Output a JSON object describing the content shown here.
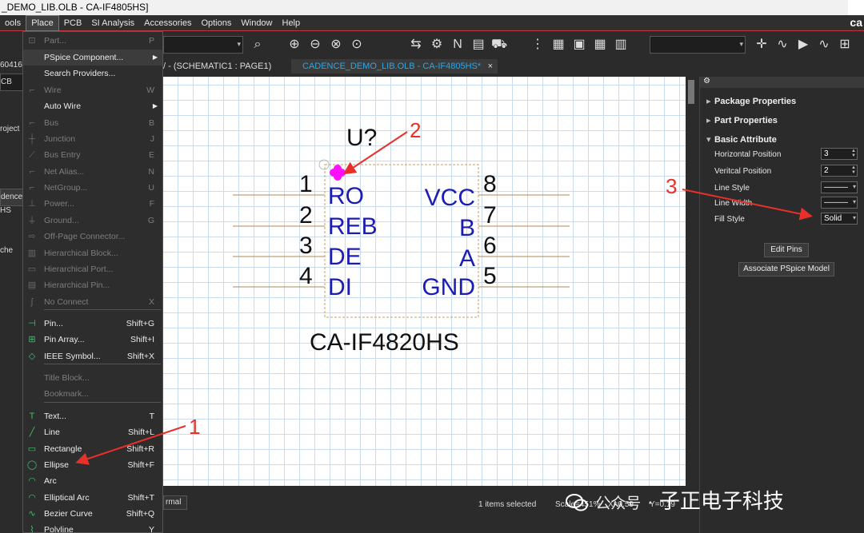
{
  "window": {
    "title": "_DEMO_LIB.OLB - CA-IF4805HS]"
  },
  "menu": {
    "items": [
      "ools",
      "Place",
      "PCB",
      "SI Analysis",
      "Accessories",
      "Options",
      "Window",
      "Help"
    ],
    "brand": "ca"
  },
  "left_panel": {
    "texts": [
      "60416",
      "CB",
      "roject",
      "dence",
      "HS",
      "che"
    ]
  },
  "tabs": {
    "inactive": "/ - (SCHEMATIC1 : PAGE1)",
    "active": "CADENCE_DEMO_LIB.OLB - CA-IF4805HS*",
    "close": "×"
  },
  "place_menu": {
    "items": [
      {
        "label": "Part...",
        "shortcut": "P",
        "enabled": false,
        "icon": "part-icon"
      },
      {
        "label": "PSpice Component...",
        "shortcut": "",
        "enabled": true,
        "submenu": true,
        "icon": ""
      },
      {
        "label": "Search Providers...",
        "shortcut": "",
        "enabled": true,
        "icon": ""
      },
      {
        "label": "Wire",
        "shortcut": "W",
        "enabled": false,
        "icon": "wire-icon"
      },
      {
        "label": "Auto Wire",
        "shortcut": "",
        "enabled": true,
        "submenu": true,
        "icon": ""
      },
      {
        "label": "Bus",
        "shortcut": "B",
        "enabled": false,
        "icon": "bus-icon"
      },
      {
        "label": "Junction",
        "shortcut": "J",
        "enabled": false,
        "icon": "junction-icon"
      },
      {
        "label": "Bus Entry",
        "shortcut": "E",
        "enabled": false,
        "icon": "bus-entry-icon"
      },
      {
        "label": "Net Alias...",
        "shortcut": "N",
        "enabled": false,
        "icon": "net-alias-icon"
      },
      {
        "label": "NetGroup...",
        "shortcut": "U",
        "enabled": false,
        "icon": "netgroup-icon"
      },
      {
        "label": "Power...",
        "shortcut": "F",
        "enabled": false,
        "icon": "power-icon"
      },
      {
        "label": "Ground...",
        "shortcut": "G",
        "enabled": false,
        "icon": "ground-icon"
      },
      {
        "label": "Off-Page Connector...",
        "shortcut": "",
        "enabled": false,
        "icon": "off-page-icon"
      },
      {
        "label": "Hierarchical Block...",
        "shortcut": "",
        "enabled": false,
        "icon": "hier-block-icon"
      },
      {
        "label": "Hierarchical Port...",
        "shortcut": "",
        "enabled": false,
        "icon": "hier-port-icon"
      },
      {
        "label": "Hierarchical Pin...",
        "shortcut": "",
        "enabled": false,
        "icon": "hier-pin-icon"
      },
      {
        "label": "No Connect",
        "shortcut": "X",
        "enabled": false,
        "icon": "no-connect-icon"
      },
      {
        "label": "Pin...",
        "shortcut": "Shift+G",
        "enabled": true,
        "icon": "pin-icon"
      },
      {
        "label": "Pin Array...",
        "shortcut": "Shift+I",
        "enabled": true,
        "icon": "pin-array-icon"
      },
      {
        "label": "IEEE Symbol...",
        "shortcut": "Shift+X",
        "enabled": true,
        "icon": "ieee-symbol-icon"
      },
      {
        "label": "Title Block...",
        "shortcut": "",
        "enabled": false,
        "icon": ""
      },
      {
        "label": "Bookmark...",
        "shortcut": "",
        "enabled": false,
        "icon": ""
      },
      {
        "label": "Text...",
        "shortcut": "T",
        "enabled": true,
        "icon": "text-icon"
      },
      {
        "label": "Line",
        "shortcut": "Shift+L",
        "enabled": true,
        "icon": "line-icon"
      },
      {
        "label": "Rectangle",
        "shortcut": "Shift+R",
        "enabled": true,
        "icon": "rectangle-icon"
      },
      {
        "label": "Ellipse",
        "shortcut": "Shift+F",
        "enabled": true,
        "icon": "ellipse-icon"
      },
      {
        "label": "Arc",
        "shortcut": "",
        "enabled": true,
        "icon": "arc-icon"
      },
      {
        "label": "Elliptical Arc",
        "shortcut": "Shift+T",
        "enabled": true,
        "icon": "elliptical-arc-icon"
      },
      {
        "label": "Bezier Curve",
        "shortcut": "Shift+Q",
        "enabled": true,
        "icon": "bezier-icon"
      },
      {
        "label": "Polyline",
        "shortcut": "Y",
        "enabled": true,
        "icon": "polyline-icon"
      }
    ]
  },
  "schematic": {
    "refdes": "U?",
    "part_name": "CA-IF4820HS",
    "left_pins": [
      {
        "num": "1",
        "name": "RO"
      },
      {
        "num": "2",
        "name": "REB"
      },
      {
        "num": "3",
        "name": "DE"
      },
      {
        "num": "4",
        "name": "DI"
      }
    ],
    "right_pins": [
      {
        "num": "8",
        "name": "VCC"
      },
      {
        "num": "7",
        "name": "B"
      },
      {
        "num": "6",
        "name": "A"
      },
      {
        "num": "5",
        "name": "GND"
      }
    ]
  },
  "properties": {
    "sections": [
      "Package Properties",
      "Part Properties",
      "Basic Attribute"
    ],
    "fields": [
      {
        "label": "Horizontal Position",
        "value": "3"
      },
      {
        "label": "Veritcal Position",
        "value": "2"
      },
      {
        "label": "Line Style",
        "value": "———"
      },
      {
        "label": "Line Width",
        "value": "———"
      },
      {
        "label": "Fill Style",
        "value": "Solid"
      }
    ],
    "buttons": [
      "Edit Pins",
      "Associate PSpice Model"
    ]
  },
  "status": {
    "mode": "rmal",
    "selected": "1 items selected",
    "scale": "Scale=451%",
    "x": "X=0.59",
    "y": "Y=0.19"
  },
  "annotations": {
    "one": "1",
    "two": "2",
    "three": "3"
  },
  "watermark": {
    "text1": "公众号",
    "dot": "·",
    "text2": "子正电子科技"
  },
  "colors": {
    "accent_red": "#e8302a",
    "pin_blue": "#1b1bb5",
    "tab_blue": "#2aa8e6",
    "marker_magenta": "#ff10ff"
  }
}
